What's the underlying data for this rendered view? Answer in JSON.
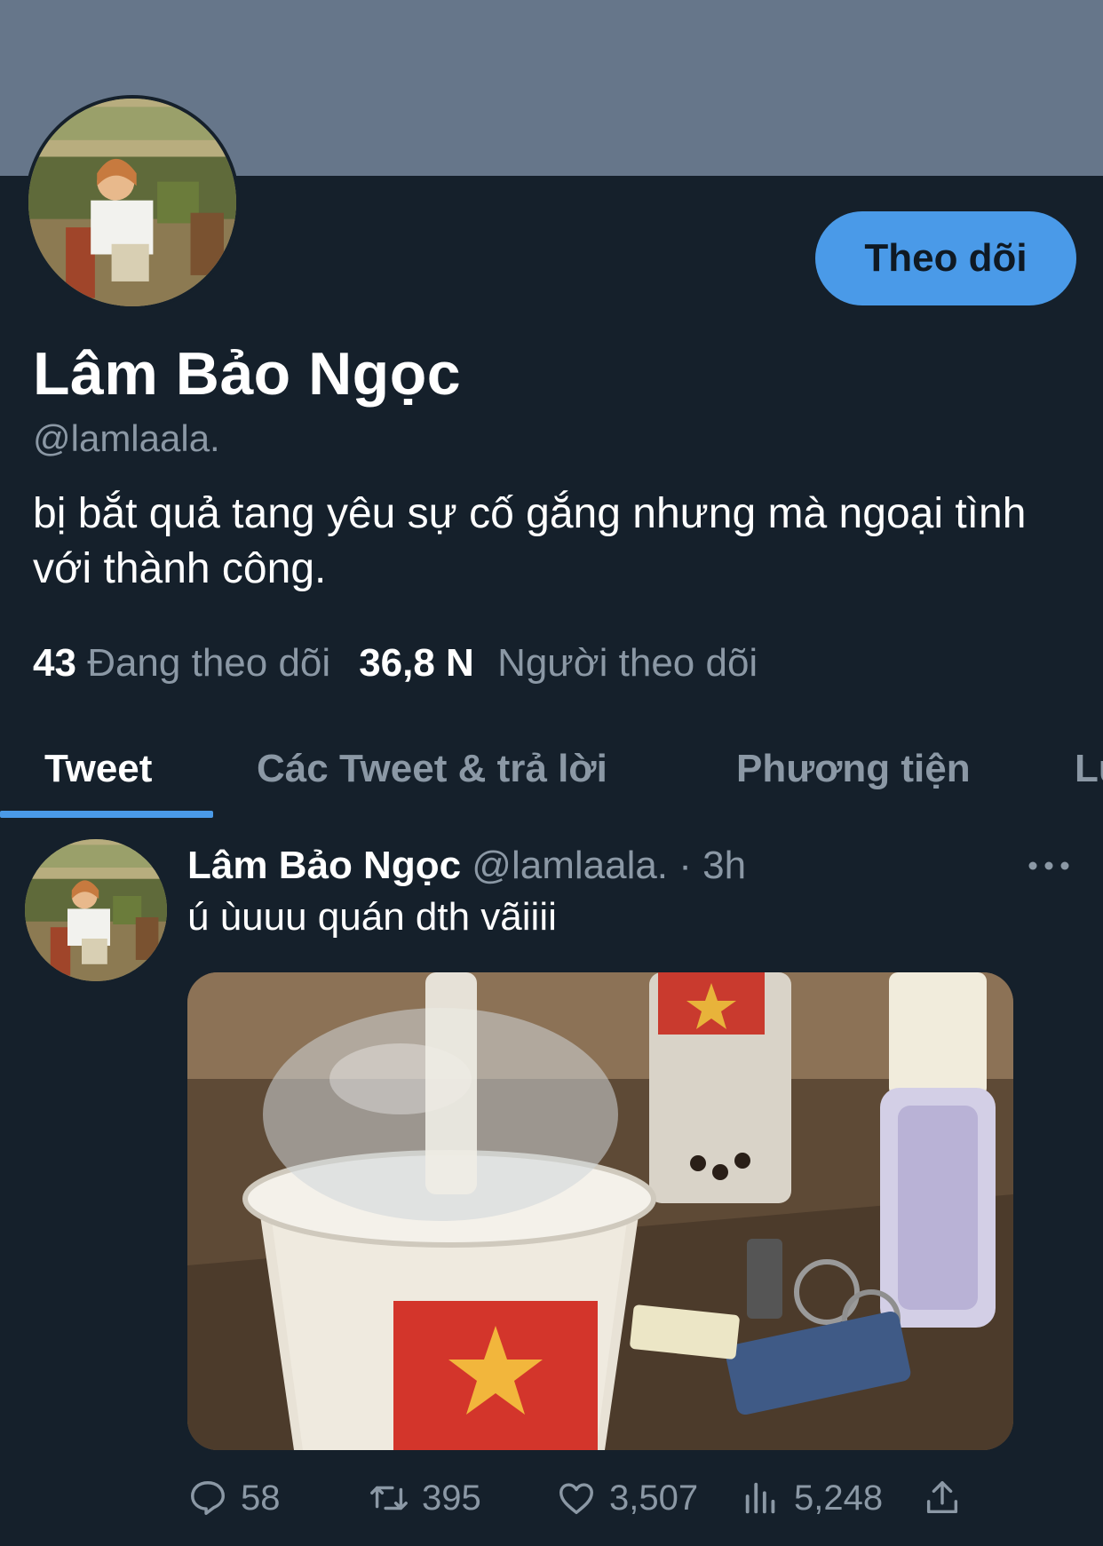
{
  "profile": {
    "display_name": "Lâm Bảo Ngọc",
    "handle": "@lamlaala.",
    "bio": "bị bắt quả tang yêu sự cố gắng nhưng mà ngoại tình với thành công.",
    "follow_button": "Theo dõi",
    "following_count": "43",
    "following_label": "Đang theo dõi",
    "followers_count": "36,8 N",
    "followers_label": "Người theo dõi"
  },
  "tabs": [
    {
      "label": "Tweet",
      "active": true
    },
    {
      "label": "Các Tweet & trả lời",
      "active": false
    },
    {
      "label": "Phương tiện",
      "active": false
    },
    {
      "label": "Lư",
      "active": false
    }
  ],
  "tweet": {
    "author_name": "Lâm Bảo Ngọc",
    "author_handle": "@lamlaala.",
    "separator": "·",
    "time": "3h",
    "text": "ú ùuuu quán dth vãiiii",
    "replies": "58",
    "retweets": "395",
    "likes": "3,507",
    "views": "5,248"
  },
  "icons": {
    "more": "more-dots-icon",
    "reply": "reply-icon",
    "retweet": "retweet-icon",
    "like": "heart-icon",
    "views": "views-icon",
    "share": "share-icon"
  },
  "colors": {
    "background": "#15202b",
    "banner": "#66768a",
    "accent": "#4a9ae8",
    "secondary_text": "#8b98a5"
  }
}
